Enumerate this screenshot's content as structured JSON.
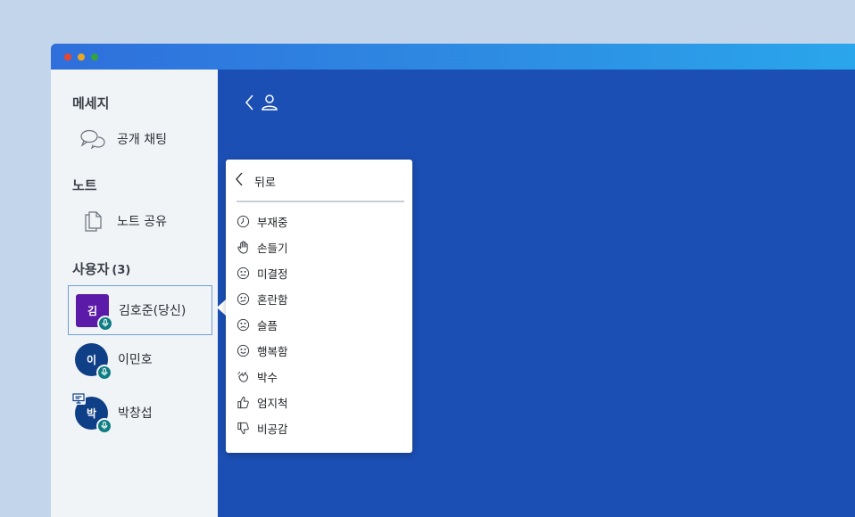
{
  "window": {
    "controls": [
      "close",
      "minimize",
      "maximize"
    ]
  },
  "sidebar": {
    "messages_title": "메세지",
    "public_chat": {
      "icon": "chat-bubbles-icon",
      "label": "공개 채팅"
    },
    "notes_title": "노트",
    "shared_notes": {
      "icon": "notes-copy-icon",
      "label": "노트 공유"
    },
    "users_title": "사용자",
    "users_count": "(3)",
    "users": [
      {
        "initial": "김",
        "name": "김호준(당신)",
        "avatar_color": "#5b1aa8",
        "selected": true
      },
      {
        "initial": "이",
        "name": "이민호",
        "avatar_color": "#0f3f86",
        "selected": false
      },
      {
        "initial": "박",
        "name": "박창섭",
        "avatar_color": "#0f3f86",
        "selected": false,
        "presenter": true
      }
    ]
  },
  "header": {
    "back_icon": "chevron-left-icon",
    "user_icon": "user-icon"
  },
  "status_menu": {
    "back_label": "뒤로",
    "items": [
      {
        "icon": "clock-icon",
        "label": "부재중"
      },
      {
        "icon": "hand-icon",
        "label": "손들기"
      },
      {
        "icon": "neutral-face-icon",
        "label": "미결정"
      },
      {
        "icon": "confused-face-icon",
        "label": "혼란함"
      },
      {
        "icon": "sad-face-icon",
        "label": "슬픔"
      },
      {
        "icon": "happy-face-icon",
        "label": "행복함"
      },
      {
        "icon": "clap-icon",
        "label": "박수"
      },
      {
        "icon": "thumbs-up-icon",
        "label": "엄지척"
      },
      {
        "icon": "thumbs-down-icon",
        "label": "비공감"
      }
    ]
  },
  "colors": {
    "main_bg": "#1b4fb3",
    "sidebar_bg": "#f1f4f7",
    "badge": "#0d7d83",
    "selected_border": "#6e9fd6"
  }
}
